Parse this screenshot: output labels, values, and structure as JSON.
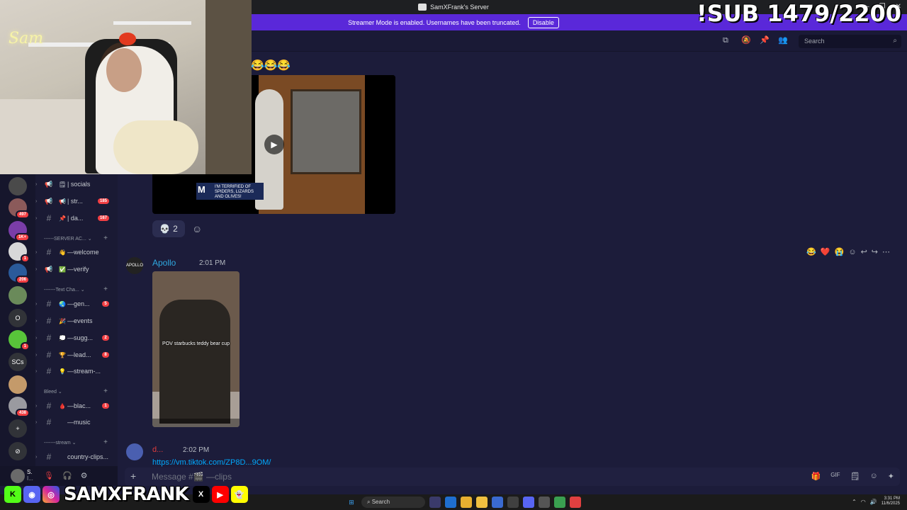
{
  "window": {
    "title": "SamXFrank's Server",
    "controls": [
      "—",
      "❐",
      "✕"
    ]
  },
  "banner": {
    "text": "Streamer Mode is enabled. Usernames have been truncated.",
    "button": "Disable"
  },
  "header": {
    "search_placeholder": "Search",
    "icons": [
      "threads-icon",
      "notification-icon",
      "pin-icon",
      "members-icon"
    ]
  },
  "overlay": {
    "sub_goal": "!SUB 1479/2200",
    "neon_sign": "Sam",
    "social_name": "SAMXFRANK"
  },
  "servers": [
    {
      "label": "",
      "badge": "",
      "color": "#4a4a4a"
    },
    {
      "label": "",
      "badge": "497",
      "color": "#8b5a5a"
    },
    {
      "label": "",
      "badge": "1K+",
      "color": "#7a3da8"
    },
    {
      "label": "",
      "badge": "1",
      "color": "#d8d8d8"
    },
    {
      "label": "",
      "badge": "206",
      "color": "#2a5a9a"
    },
    {
      "label": "",
      "badge": "",
      "color": "#6a8a5a"
    },
    {
      "label": "O",
      "badge": "",
      "color": "#313338"
    },
    {
      "label": "",
      "badge": "1",
      "color": "#58c43a"
    },
    {
      "label": "SCs",
      "badge": "",
      "color": "#313338"
    },
    {
      "label": "",
      "badge": "",
      "color": "#c49a6a"
    },
    {
      "label": "",
      "badge": "438",
      "color": "#9a9aa0"
    },
    {
      "label": "+",
      "badge": "",
      "color": "#313338"
    },
    {
      "label": "⊘",
      "badge": "",
      "color": "#313338"
    }
  ],
  "channels": [
    {
      "type": "announce",
      "emoji": "🗒",
      "name": "| socials",
      "count": ""
    },
    {
      "type": "announce",
      "emoji": "📢",
      "name": "| str...",
      "count": "185"
    },
    {
      "type": "text",
      "emoji": "📌",
      "name": "| da...",
      "count": "167"
    }
  ],
  "categories": [
    {
      "label": "------SERVER AC... ⌄"
    },
    {
      "label": "-------Text Cha... ⌄"
    },
    {
      "label": "Bleed ⌄"
    },
    {
      "label": "-------stream ⌄"
    }
  ],
  "channels_server": [
    {
      "type": "text",
      "emoji": "👋",
      "name": "—welcome",
      "count": ""
    },
    {
      "type": "announce",
      "emoji": "✅",
      "name": "—verify",
      "count": ""
    }
  ],
  "channels_text": [
    {
      "type": "text",
      "emoji": "🌏",
      "name": "—gen...",
      "count": "5"
    },
    {
      "type": "text",
      "emoji": "🎉",
      "name": "—events",
      "count": ""
    },
    {
      "type": "text",
      "emoji": "💭",
      "name": "—sugg...",
      "count": "2"
    },
    {
      "type": "text",
      "emoji": "🏆",
      "name": "—lead...",
      "count": "8"
    },
    {
      "type": "text",
      "emoji": "💡",
      "name": "—stream-...",
      "count": ""
    }
  ],
  "channels_bleed": [
    {
      "type": "text",
      "emoji": "🩸",
      "name": "—blac...",
      "count": "1"
    },
    {
      "type": "text",
      "emoji": "",
      "name": "—music",
      "count": ""
    }
  ],
  "channels_stream": [
    {
      "type": "text",
      "emoji": "",
      "name": "country-clips...",
      "count": ""
    }
  ],
  "user": {
    "name": "S.",
    "sub": "I..."
  },
  "messages": {
    "emoji_line": "😂😂😂",
    "video1_caption": "I'M TERRIFIED OF SPIDERS, LIZARDS AND OLIVES!",
    "video1_logo": "M",
    "reaction_emoji": "💀",
    "reaction_count": "2",
    "msg2_author": "Apollo",
    "msg2_avatar": "APOLLO",
    "msg2_time": "2:01 PM",
    "video2_caption": "POV starbucks teddy bear cup",
    "msg3_author": "d...",
    "msg3_time": "2:02 PM",
    "msg3_link": "https://vm.tiktok.com/ZP8D...9OM/"
  },
  "hover_actions": [
    "😂",
    "❤️",
    "😭",
    "☺",
    "↩",
    "↪",
    "⋯"
  ],
  "composer": {
    "placeholder": "Message #🎬 —clips",
    "tools": [
      "🎁",
      "GIF",
      "🗒",
      "☺",
      "✦"
    ]
  },
  "taskbar": {
    "search": "Search",
    "time": "3:31 PM",
    "date": "11/6/2025"
  },
  "colors": {
    "banner": "#5a28d9",
    "apollo": "#2fa8e0",
    "user3": "#e03c3c",
    "badge": "#f23f43"
  }
}
